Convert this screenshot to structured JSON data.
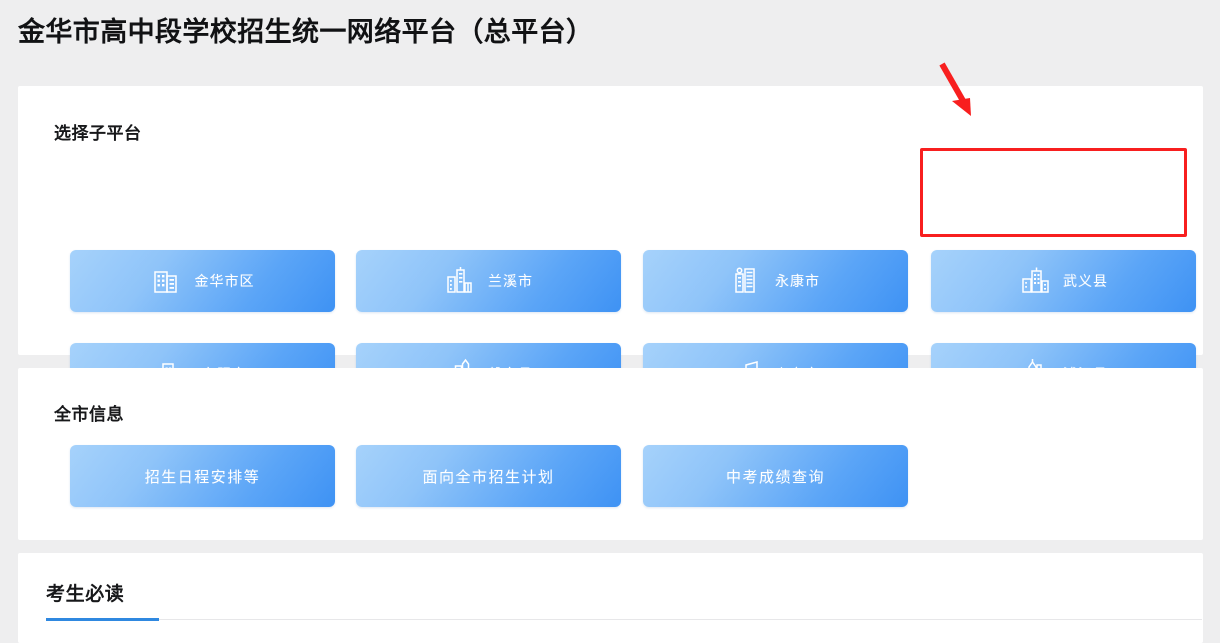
{
  "header": {
    "title": "金华市高中段学校招生统一网络平台（总平台）"
  },
  "sub_platform": {
    "section_title": "选择子平台",
    "buttons": [
      {
        "label": "金华市区",
        "icon": "office-building-icon"
      },
      {
        "label": "兰溪市",
        "icon": "city-buildings-icon"
      },
      {
        "label": "永康市",
        "icon": "tower-building-icon"
      },
      {
        "label": "武义县",
        "icon": "highrise-building-icon"
      },
      {
        "label": "东阳市",
        "icon": "building-leaf-icon"
      },
      {
        "label": "磐安县",
        "icon": "skyline-buildings-icon"
      },
      {
        "label": "义乌市",
        "icon": "factory-building-icon"
      },
      {
        "label": "浦江县",
        "icon": "castle-skyline-icon"
      }
    ]
  },
  "city_info": {
    "section_title": "全市信息",
    "buttons": [
      {
        "label": "招生日程安排等"
      },
      {
        "label": "面向全市招生计划"
      },
      {
        "label": "中考成绩查询"
      }
    ]
  },
  "notice": {
    "title": "考生必读"
  },
  "annotation": {
    "highlight_target": "武义县",
    "box_color": "#f81f1f",
    "arrow_color": "#f81f1f"
  },
  "colors": {
    "page_background": "#eeeeef",
    "card_background": "#ffffff",
    "button_gradient_start": "#a6d2fb",
    "button_gradient_end": "#3e92f4",
    "accent_underline": "#2f88e0",
    "title_text": "#111214"
  }
}
